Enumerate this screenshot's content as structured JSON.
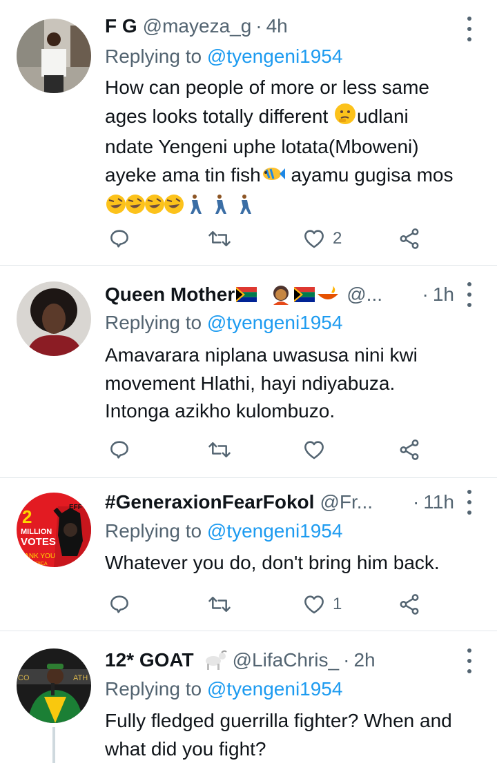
{
  "tweets": [
    {
      "name": "F G",
      "handle": "@mayeza_g",
      "time": "4h",
      "replying_label": "Replying to",
      "replying_to": "@tyengeni1954",
      "lines": [
        "How can people of more or less same",
        "ages looks totally different",
        "udlani",
        "ndate Yengeni uphe lotata(Mboweni)",
        "ayeke ama tin fish",
        "ayamu gugisa mos"
      ],
      "likes": "2"
    },
    {
      "name": "Queen Mother",
      "handle": "@...",
      "time": "1h",
      "replying_label": "Replying to",
      "replying_to": "@tyengeni1954",
      "lines": [
        "Amavarara niplana uwasusa nini kwi",
        "movement Hlathi, hayi ndiyabuza.",
        "Intonga azikho kulombuzo."
      ],
      "likes": ""
    },
    {
      "name": "#GeneraxionFearFokol",
      "handle": "@Fr...",
      "time": "11h",
      "replying_label": "Replying to",
      "replying_to": "@tyengeni1954",
      "lines": [
        "Whatever you do, don't bring him back."
      ],
      "likes": "1",
      "avatar_text": {
        "big": "2",
        "line1": "MILLION",
        "line2": "VOTES",
        "line3": "HANK YOU",
        "line4": "TH AFRICA",
        "party": "EFF"
      }
    },
    {
      "name": "12* GOAT",
      "handle": "@LifaChris_",
      "time": "2h",
      "replying_label": "Replying to",
      "replying_to": "@tyengeni1954",
      "lines": [
        "Fully fledged guerrilla fighter? When and",
        "what did you fight?"
      ],
      "avatar_text": {
        "left": "CO",
        "right": "ATH"
      }
    }
  ],
  "icons": {
    "reply": "reply-icon",
    "retweet": "retweet-icon",
    "like": "heart-icon",
    "share": "share-icon",
    "more": "more-vertical-icon"
  },
  "colors": {
    "accent": "#1d9bf0",
    "secondary_text": "#536471",
    "divider": "#e1e6ea"
  }
}
